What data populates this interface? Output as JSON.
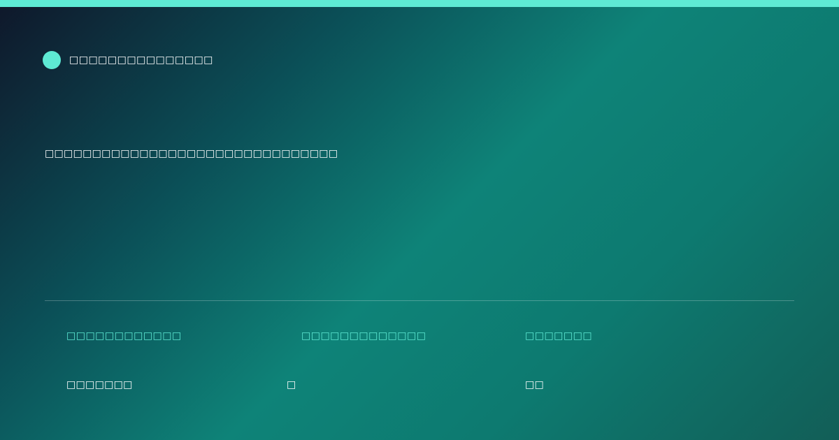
{
  "brand": {
    "name": "□□□□□□□□□□□□□□□",
    "dot_color": "#5eead4"
  },
  "headline": "□□□□□□□□□□□□□□□□□□□□□□□□□□□□□□□",
  "stats": [
    {
      "label": "□□□□□□□□□□□□",
      "value": "□□□□□□□"
    },
    {
      "label": "□□□□□□□□□□□□□",
      "value": "□"
    },
    {
      "label": "□□□□□□□",
      "value": "□□"
    }
  ],
  "colors": {
    "accent": "#5eead4",
    "background_dark": "#0f172a",
    "background_teal": "#0e8378"
  }
}
